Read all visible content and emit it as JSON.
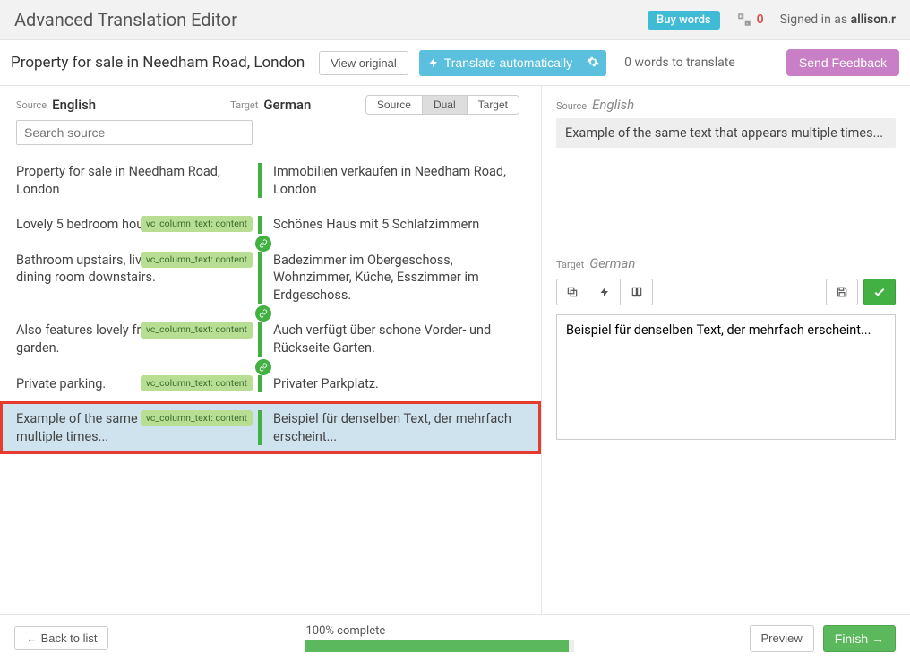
{
  "header": {
    "app_title": "Advanced Translation Editor",
    "buy_words": "Buy words",
    "lang_swap_count": "0",
    "signed_in_prefix": "Signed in as ",
    "user": "allison.r"
  },
  "toolbar": {
    "doc_title": "Property for sale in Needham Road, London",
    "view_original": "View original",
    "translate_auto": "Translate automatically",
    "words_to_translate": "0 words to translate",
    "send_feedback": "Send Feedback"
  },
  "langs": {
    "source_label": "Source",
    "source_name": "English",
    "target_label": "Target",
    "target_name": "German"
  },
  "view_modes": {
    "source": "Source",
    "dual": "Dual",
    "target": "Target",
    "active": "dual"
  },
  "search": {
    "placeholder": "Search source",
    "value": ""
  },
  "segments": [
    {
      "src": "Property for sale in Needham Road, London",
      "tgt": "Immobilien verkaufen in Needham Road, London",
      "tag": null,
      "link_after": false
    },
    {
      "src": "Lovely 5 bedroom house.",
      "tgt": "Schönes Haus mit 5 Schlafzimmern",
      "tag": "vc_column_text: content",
      "link_after": true
    },
    {
      "src": "Bathroom upstairs, living room, kitchen, dining room downstairs.",
      "tgt": "Badezimmer im Obergeschoss, Wohnzimmer, Küche, Esszimmer im Erdgeschoss.",
      "tag": "vc_column_text: content",
      "link_after": true
    },
    {
      "src": "Also features lovely front and back garden.",
      "tgt": "Auch verfügt über schone Vorder- und Rückseite Garten.",
      "tag": "vc_column_text: content",
      "link_after": true
    },
    {
      "src": "Private parking.",
      "tgt": "Privater Parkplatz.",
      "tag": "vc_column_text: content",
      "link_after": false
    },
    {
      "src": "Example of the same text that appears multiple times...",
      "tgt": "Beispiel für denselben Text, der mehrfach erscheint...",
      "tag": "vc_column_text: content",
      "link_after": false,
      "selected": true
    }
  ],
  "detail": {
    "source_label": "Source",
    "source_lang": "English",
    "source_text": "Example of the same text that appears multiple times...",
    "target_label": "Target",
    "target_lang": "German",
    "target_text": "Beispiel für denselben Text, der mehrfach erscheint..."
  },
  "footer": {
    "back": "← Back to list",
    "progress_label": "100% complete",
    "progress_pct": 98,
    "preview": "Preview",
    "finish": "Finish →"
  }
}
